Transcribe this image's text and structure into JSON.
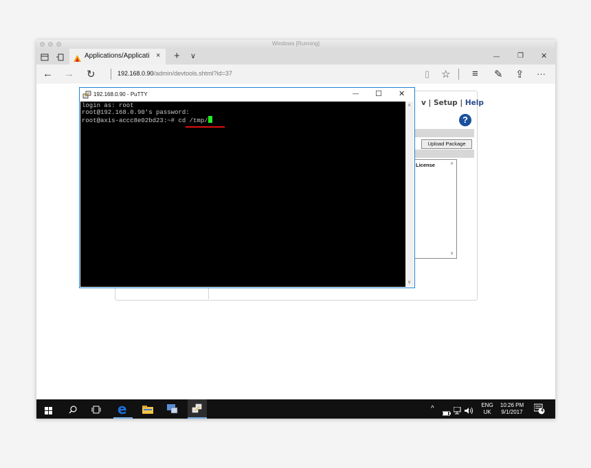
{
  "vm_window": {
    "title": "Windows [Running]"
  },
  "browser": {
    "tab_title": "Applications/Applicatio",
    "tab_close": "×",
    "new_tab": "+",
    "tab_menu": "∨",
    "url_host": "192.168.0.90",
    "url_path": "/admin/devtools.shtml?id=37",
    "window_controls": {
      "minimize": "—",
      "restore": "❐",
      "close": "✕"
    },
    "nav": {
      "back": "←",
      "forward": "→",
      "refresh": "↻"
    },
    "toolbar": {
      "reading": "▯",
      "favorite": "☆",
      "hub": "≡",
      "notes": "✎",
      "share": "⇪",
      "more": "···"
    }
  },
  "page": {
    "setup_prefix": "v | ",
    "setup_label": "Setup",
    "separator": " | ",
    "help_label": "Help",
    "help_icon": "?",
    "upload_button": "Upload Package",
    "license_label": "License"
  },
  "putty": {
    "title": "192.168.0.90 - PuTTY",
    "controls": {
      "minimize": "—",
      "maximize": "☐",
      "close": "✕"
    },
    "lines": [
      "login as: root",
      "root@192.168.0.90's password:",
      "root@axis-accc8e02bd23:~# cd /tmp/"
    ]
  },
  "taskbar": {
    "tray_chevron": "^",
    "language": "ENG",
    "locale": "UK",
    "time": "10:26 PM",
    "date": "9/1/2017",
    "notification_count": "4"
  },
  "colors": {
    "putty_border": "#1e80d6",
    "cursor": "#22ee22",
    "underline": "#e01010",
    "taskbar": "#111111",
    "edge_blue": "#1e6fd9"
  }
}
